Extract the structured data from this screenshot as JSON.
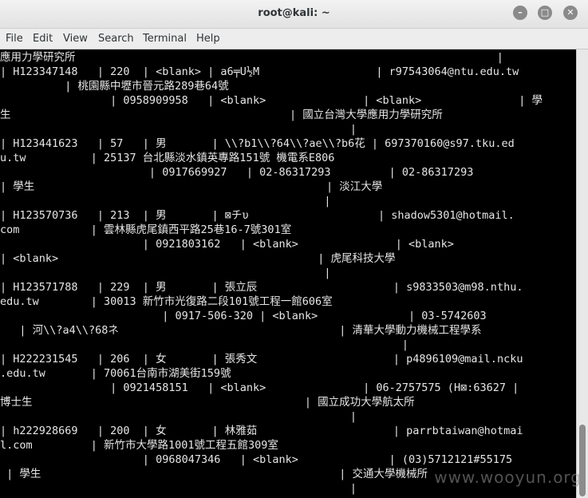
{
  "window": {
    "title": "root@kali: ~",
    "min": "–",
    "max": "□",
    "close": "✕"
  },
  "menu": [
    "File",
    "Edit",
    "View",
    "Search",
    "Terminal",
    "Help"
  ],
  "lines": [
    "應用力學研究所                                                                 |",
    "| H123347148   | 220  | <blank> | a6╤U½M                  | r97543064@ntu.edu.tw",
    "          | 桃園縣中壢市晉元路289巷64號",
    "                 | 0958909958   | <blank>               | <blank>               | 學",
    "生                                           | 國立台灣大學應用力學研究所",
    "                                                      |",
    "| H123441623   | 57   | 男       | \\\\?b1\\\\?64\\\\?ae\\\\?b6花 | 697370160@s97.tku.ed",
    "u.tw          | 25137 台北縣淡水鎮英專路151號 機電系E806",
    "                       | 0917669927   | 02-86317293         | 02-86317293",
    "| 學生                                             | 淡江大學",
    "                                                  |",
    "| H123570736   | 213  | 男       | ⊠チυ                    | shadow5301@hotmail.",
    "com           | 雲林縣虎尾鎮西平路25巷16-7號301室",
    "                      | 0921803162   | <blank>               | <blank>",
    "| <blank>                                        | 虎尾科技大學",
    "                                                  |",
    "| H123571788   | 229  | 男       | 張立辰                     | s9833503@m98.nthu.",
    "edu.tw        | 30013 新竹市光復路二段101號工程一館606室",
    "                         | 0917-506-320 | <blank>              | 03-5742603",
    "   | 河\\\\?a4\\\\?68ネ                                  | 清華大學動力機械工程學系",
    "                                                              |",
    "| H222231545   | 206  | 女       | 張秀文                     | p4896109@mail.ncku",
    ".edu.tw       | 70061台南市湖美街159號",
    "                 | 0921458151   | <blank>               | 06-2757575 (H⊠:63627 |",
    "博士生                                          | 國立成功大學航太所",
    "                                                      |",
    "| h222928669   | 200  | 女       | 林雅茹                     | parrbtaiwan@hotmai",
    "l.com         | 新竹市大學路1001號工程五館309室",
    "                      | 0968047346   | <blank>              | (03)5712121#55175",
    " | 學生                                              | 交通大學機械所",
    "                                                      |"
  ],
  "watermark": "www.wooyun.org"
}
